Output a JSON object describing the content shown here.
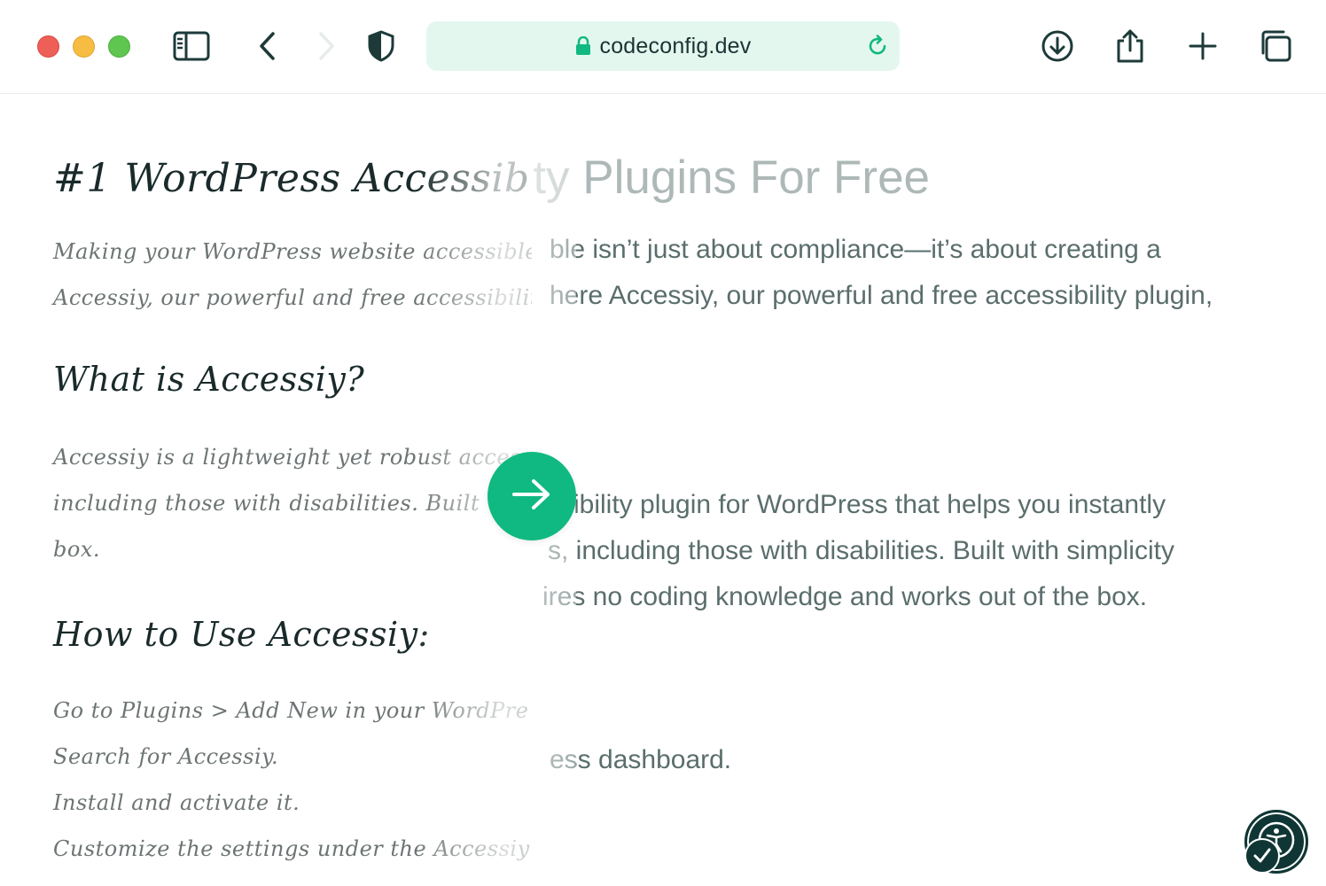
{
  "browser": {
    "url": "codeconfig.dev",
    "accent_color": "#10b981",
    "address_bg": "#e4f7ef"
  },
  "article": {
    "title": "#1 WordPress Accessibility Plugins For Free",
    "title_visible_right": "ility Plugins For Free",
    "intro_lines": [
      "Making your WordPress website accessible isn’t just about compliance—it’s about creating a",
      "Accessiy, our powerful and free accessibility plugin, here Accessiy, our powerful and free accessibility plugin,"
    ],
    "intro_lines_script": [
      "Making your WordPress website accessible isn’t",
      "Accessiy, our powerful and free accessibility plugin, co"
    ],
    "intro_lines_plain": [
      "ble isn’t just about compliance—it’s about creating a",
      "here Accessiy, our powerful and free accessibility plugin,"
    ],
    "what_heading": "What is Accessiy?",
    "what_lines_script": [
      "Accessiy is a lightweight yet robust accessibility plug",
      "including those with disabilities. Built with simpl",
      "box."
    ],
    "what_lines_plain": [
      "sibility plugin for WordPress that helps you instantly",
      "s, including those with disabilities. Built with simplicity",
      "ires no coding knowledge and works out of the box."
    ],
    "how_heading": "How to Use Accessiy:",
    "how_steps_script": [
      "Go to Plugins > Add New in your WordPre",
      "Search for Accessiy.",
      "Install and activate it.",
      "Customize the settings under the Accessiy menu to suit"
    ],
    "how_steps_plain": [
      "",
      "ess dashboard.",
      "",
      ""
    ]
  },
  "icons": {
    "sidebar": "sidebar-icon",
    "back": "chevron-left-icon",
    "forward": "chevron-right-icon",
    "shield": "shield-icon",
    "lock": "lock-icon",
    "reload": "reload-icon",
    "download": "download-icon",
    "share": "share-icon",
    "new_tab": "plus-icon",
    "tabs": "tabs-icon",
    "compare": "arrow-right-icon",
    "accessibility": "accessibility-icon"
  }
}
